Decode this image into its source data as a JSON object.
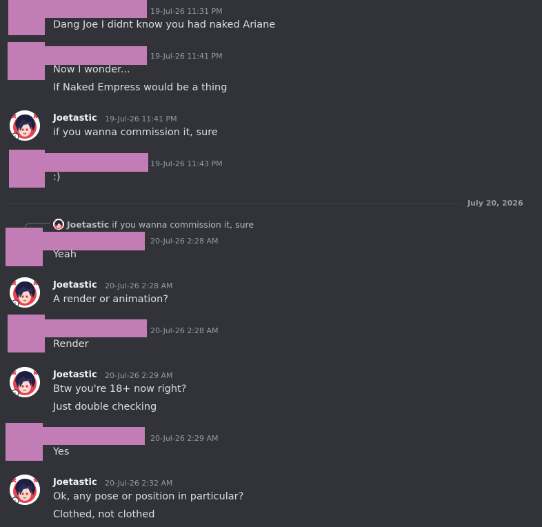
{
  "messages": [
    {
      "timestamp": "19-Jul-26 11:31 PM",
      "lines": [
        "Dang Joe I didnt know you had naked Ariane"
      ]
    },
    {
      "timestamp": "19-Jul-26 11:41 PM",
      "lines": [
        "Now I wonder...",
        "If Naked Empress would be a thing"
      ]
    },
    {
      "author": "Joetastic",
      "timestamp": "19-Jul-26 11:41 PM",
      "lines": [
        "if you wanna commission it, sure"
      ]
    },
    {
      "timestamp": "19-Jul-26 11:43 PM",
      "lines": [
        ":)"
      ]
    },
    {
      "timestamp": "20-Jul-26 2:28 AM",
      "lines": [
        "Yeah"
      ],
      "reply": {
        "author": "Joetastic",
        "text": "if you wanna commission it, sure"
      }
    },
    {
      "author": "Joetastic",
      "timestamp": "20-Jul-26 2:28 AM",
      "lines": [
        "A render or animation?"
      ]
    },
    {
      "timestamp": "20-Jul-26 2:28 AM",
      "lines": [
        "Render"
      ]
    },
    {
      "author": "Joetastic",
      "timestamp": "20-Jul-26 2:29 AM",
      "lines": [
        "Btw you're 18+ now right?",
        "Just double checking"
      ]
    },
    {
      "timestamp": "20-Jul-26 2:29 AM",
      "lines": [
        "Yes"
      ]
    },
    {
      "author": "Joetastic",
      "timestamp": "20-Jul-26 2:32 AM",
      "lines": [
        "Ok, any pose or position in particular?",
        "Clothed, not clothed"
      ]
    }
  ],
  "date_divider": "July 20, 2026",
  "colors": {
    "background": "#313338",
    "redaction": "#c27db7"
  }
}
